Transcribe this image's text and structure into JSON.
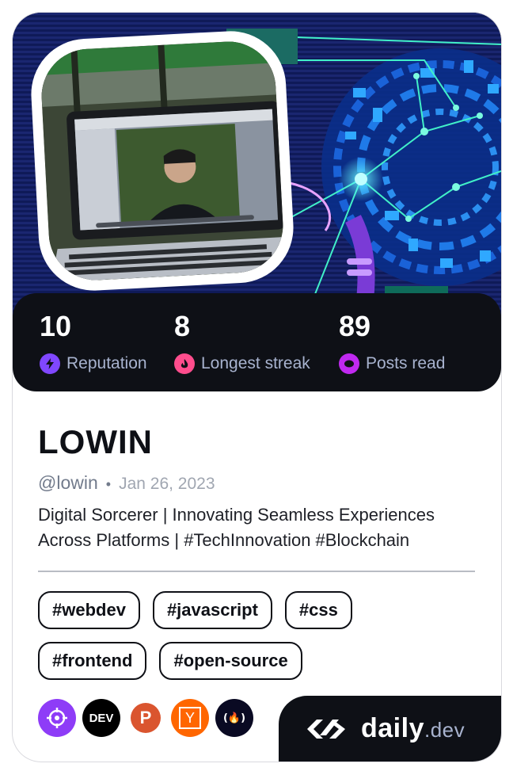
{
  "profile": {
    "name": "LOWIN",
    "handle": "@lowin",
    "separator": "•",
    "joined": "Jan 26, 2023",
    "bio_line1": "Digital Sorcerer | Innovating Seamless Experiences",
    "bio_line2": "Across Platforms | #TechInnovation #Blockchain"
  },
  "stats": [
    {
      "value": "10",
      "label": "Reputation",
      "icon": "lightning-icon",
      "color": "#8047ff"
    },
    {
      "value": "8",
      "label": "Longest streak",
      "icon": "flame-icon",
      "color": "#ff4d8d"
    },
    {
      "value": "89",
      "label": "Posts read",
      "icon": "eye-ring-icon",
      "color": "#c029f0"
    }
  ],
  "tags": [
    [
      "#webdev",
      "#javascript",
      "#css"
    ],
    [
      "#frontend",
      "#open-source"
    ]
  ],
  "socials": [
    {
      "name": "crosshair-icon",
      "color": "#8e3cf7"
    },
    {
      "name": "dev-icon",
      "label": "DEV",
      "color": "#000000"
    },
    {
      "name": "product-hunt-icon",
      "label": "P",
      "color": "#da552f"
    },
    {
      "name": "hacker-news-icon",
      "label": "Y",
      "color": "#ff6600"
    },
    {
      "name": "freecodecamp-icon",
      "label": "(🔥)",
      "color": "#0a0a23"
    }
  ],
  "brand": {
    "word": "daily",
    "tld": ".dev"
  },
  "colors": {
    "card_dark": "#0e1016",
    "stat_label": "#a8b3cf",
    "banner_bg": "#0c1650",
    "circuit": "#3ad8e8"
  }
}
